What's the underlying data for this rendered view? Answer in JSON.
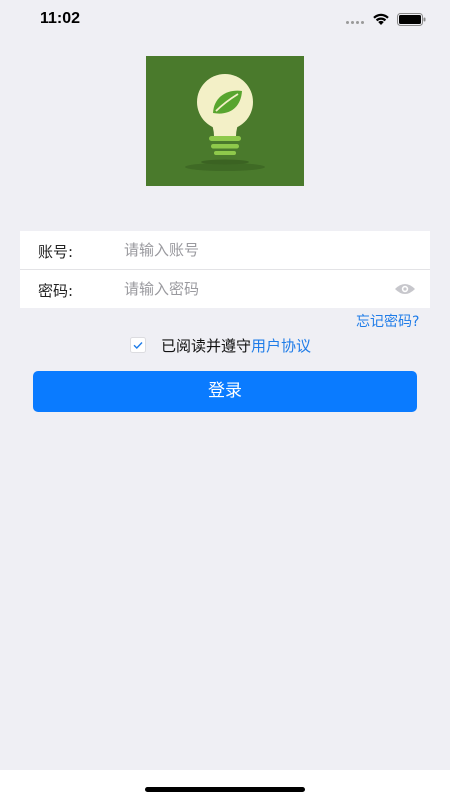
{
  "status_bar": {
    "time": "11:02"
  },
  "logo": {
    "icon": "lightbulb-leaf-logo",
    "background_color": "#4a7a2c"
  },
  "form": {
    "account": {
      "label": "账号:",
      "placeholder": "请输入账号",
      "value": ""
    },
    "password": {
      "label": "密码:",
      "placeholder": "请输入密码",
      "value": "",
      "toggle_icon": "eye-icon"
    }
  },
  "forgot_password": "忘记密码?",
  "agreement": {
    "checked": true,
    "text": "已阅读并遵守",
    "link": "用户协议"
  },
  "login_button": "登录",
  "colors": {
    "accent": "#0a7bff",
    "link": "#1f7ce8",
    "background": "#efeff4"
  }
}
